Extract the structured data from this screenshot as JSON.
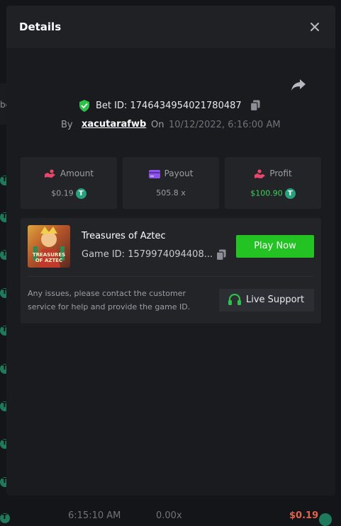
{
  "background": {
    "side_text": "bo",
    "bottom": {
      "time": "6:15:10 AM",
      "payout": "0.00x",
      "profit": "$0.19"
    }
  },
  "modal": {
    "title": "Details",
    "bet": {
      "label": "Bet ID:",
      "id": "1746434954021780487"
    },
    "by_label": "By",
    "username": "xacutarafwb",
    "on_label": "On",
    "datetime": "10/12/2022, 6:16:00 AM",
    "stats": [
      {
        "label": "Amount",
        "value": "$0.19",
        "icon": "hand-coins-icon"
      },
      {
        "label": "Payout",
        "value": "505.8 x",
        "icon": "card-icon"
      },
      {
        "label": "Profit",
        "value": "$100.90",
        "icon": "hand-money-icon"
      }
    ],
    "game": {
      "title": "Treasures of Aztec",
      "thumb_text": "TREASURES OF AZTEC",
      "id_label": "Game ID: 1579974094408...",
      "play_label": "Play Now"
    },
    "support": {
      "note": "Any issues, please contact the customer service for help and provide the game ID.",
      "button_label": "Live Support"
    },
    "coin_symbol": "T"
  },
  "colors": {
    "accent_green": "#22c322",
    "profit_green": "#3ad15a",
    "coin": "#26a17b",
    "loss_red": "#e0634b"
  }
}
